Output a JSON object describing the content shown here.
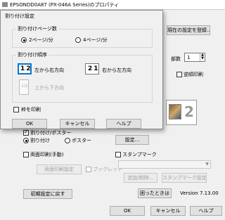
{
  "window": {
    "title": "EPSONDD0A87 (PX-046A Series)のプロパティ",
    "current_settings_button": "現在の設定を登録...",
    "copies_label": "部数",
    "copies_value": "1",
    "reverse_print_label": "逆順印刷",
    "preview_page_number": "2",
    "split_print_label": "割り付け/ポスター",
    "split_radio_label": "割り付け",
    "poster_radio_label": "ポスター",
    "settings_button": "設定...",
    "duplex_label": "両面印刷(手動)",
    "duplex_settings_button": "両面印刷設定",
    "booklet_label": "ブックレット",
    "stamp_label": "スタンプマーク",
    "stamp_add_button": "追加/削除...",
    "stamp_settings_button": "スタンプマーク設定...",
    "reset_button": "初期設定に戻す",
    "help_trouble_button": "困ったときは",
    "version": "Version 7.13.00",
    "ok": "OK",
    "cancel": "キャンセル",
    "help": "ヘルプ"
  },
  "dialog": {
    "title": "割り付け設定",
    "pages_group_title": "割り付けページ数",
    "two_pages": "2ページ/分",
    "four_pages": "4ページ/分",
    "order_group_title": "割り付け順序",
    "order_options": [
      {
        "icon": "12",
        "label": "左から右方向"
      },
      {
        "icon": "21",
        "label": "右から左方向"
      },
      {
        "icon": "1/2",
        "label": "上から下方向"
      }
    ],
    "border_label": "枠を印刷",
    "ok": "OK",
    "cancel": "キャンセル",
    "help": "ヘルプ"
  },
  "colors": {
    "accent_blue": "#0078d7",
    "window_bg": "#f0f0f0",
    "button_bg": "#e1e1e1"
  }
}
